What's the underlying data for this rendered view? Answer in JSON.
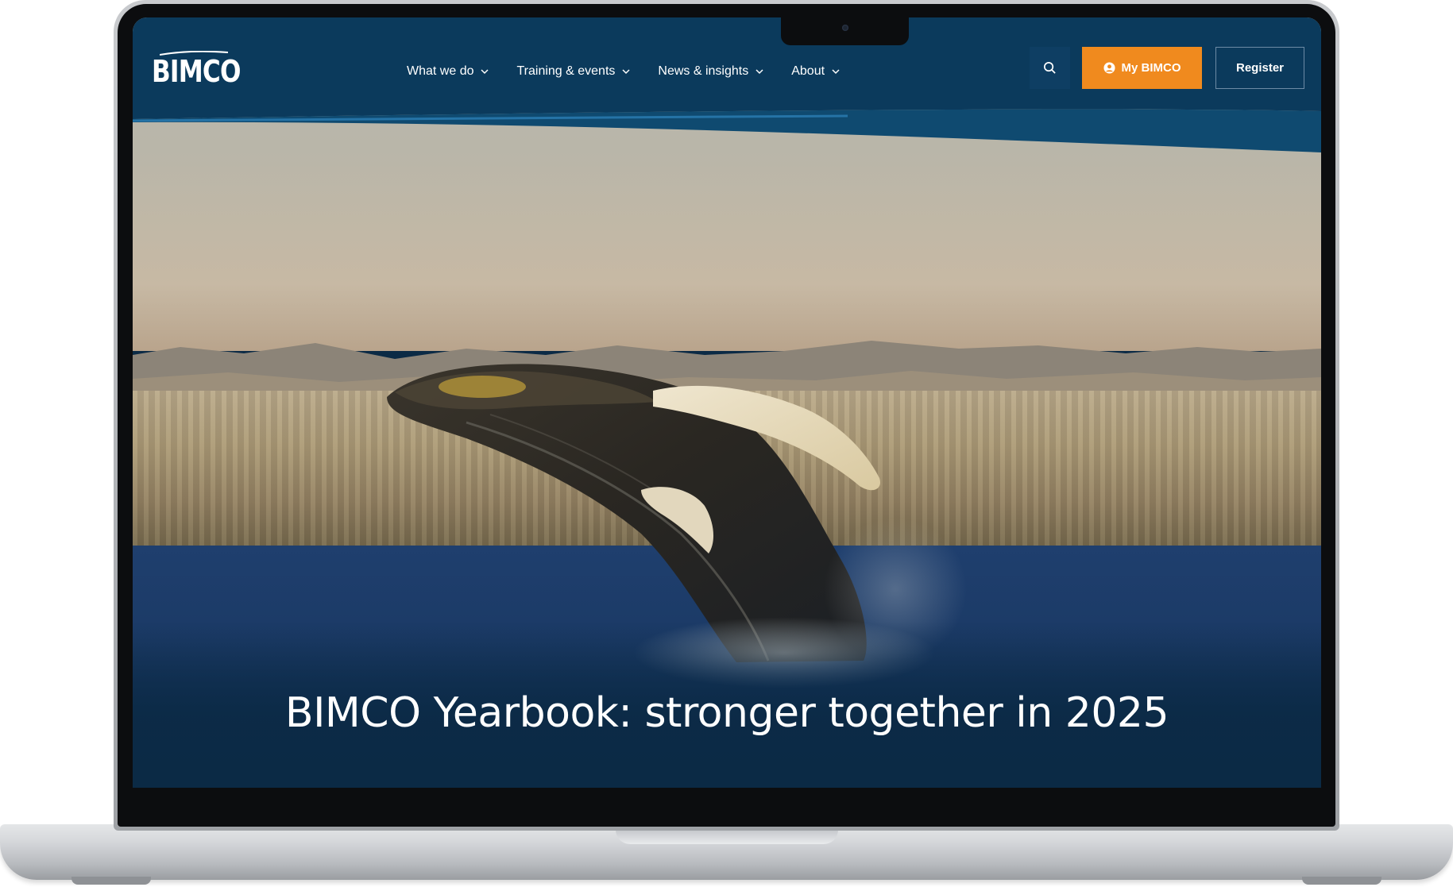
{
  "brand": {
    "logo_text": "BIMCO",
    "primary_color": "#0b2a45",
    "accent_color": "#f08a1e"
  },
  "nav": {
    "items": [
      {
        "label": "What we do",
        "icon": "chevron-down-icon"
      },
      {
        "label": "Training & events",
        "icon": "chevron-down-icon"
      },
      {
        "label": "News & insights",
        "icon": "chevron-down-icon"
      },
      {
        "label": "About",
        "icon": "chevron-down-icon"
      }
    ]
  },
  "header_actions": {
    "search_icon": "search-icon",
    "my_bimco_label": "My BIMCO",
    "my_bimco_icon": "user-circle-icon",
    "register_label": "Register"
  },
  "hero": {
    "title": "BIMCO Yearbook: stronger together in 2025",
    "image_subject": "humpback-whale-breaching"
  }
}
